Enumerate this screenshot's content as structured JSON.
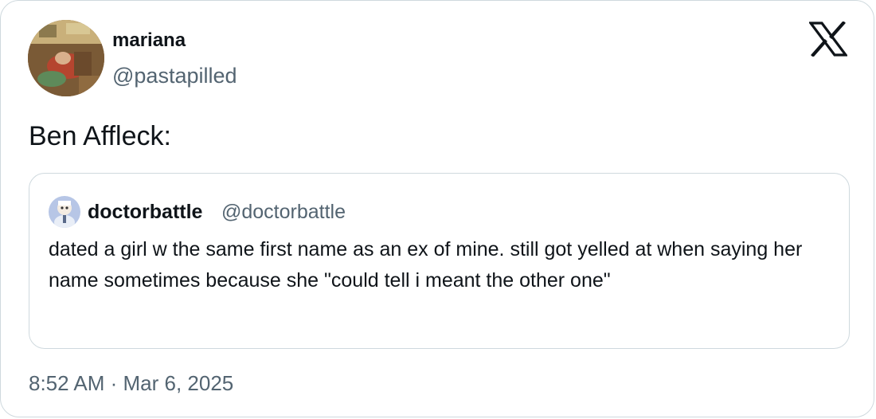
{
  "author": {
    "display_name": "mariana",
    "handle": "@pastapilled",
    "avatar_icon": "profile-photo"
  },
  "brand_icon": "x-logo-icon",
  "tweet": {
    "text": "Ben Affleck:"
  },
  "quoted_tweet": {
    "display_name": "doctorbattle",
    "handle": "@doctorbattle",
    "avatar_icon": "profile-photo",
    "text": "dated a girl w the same first name as an ex of mine. still got yelled at when saying her name sometimes because she \"could tell i meant the other one\""
  },
  "timestamp": "8:52 AM · Mar 6, 2025",
  "colors": {
    "text_primary": "#0f1419",
    "text_secondary": "#536471",
    "border": "#cfd9de",
    "background": "#ffffff"
  }
}
